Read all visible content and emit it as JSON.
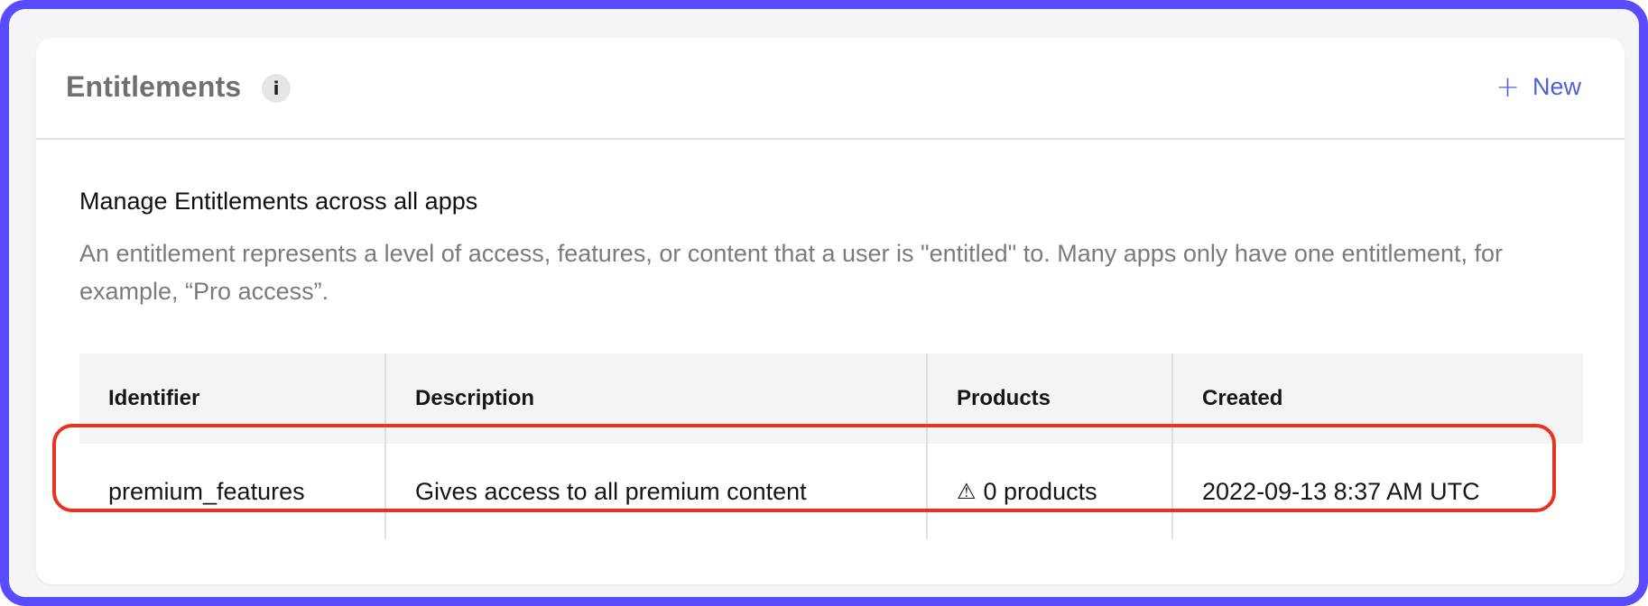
{
  "header": {
    "title": "Entitlements",
    "info_icon": "i",
    "new_icon": "+",
    "new_label": "New"
  },
  "section": {
    "heading": "Manage Entitlements across all apps",
    "description": "An entitlement represents a level of access, features, or content that a user is \"entitled\" to. Many apps only have one entitlement, for example, “Pro access”."
  },
  "table": {
    "columns": [
      "Identifier",
      "Description",
      "Products",
      "Created"
    ],
    "rows": [
      {
        "identifier": "premium_features",
        "description": "Gives access to all premium content",
        "products_icon": "⚠",
        "products": "0 products",
        "created": "2022-09-13 8:37 AM UTC"
      }
    ]
  },
  "colors": {
    "frame": "#5a4bff",
    "accent": "#4f61d8",
    "highlight": "#e8341f"
  }
}
